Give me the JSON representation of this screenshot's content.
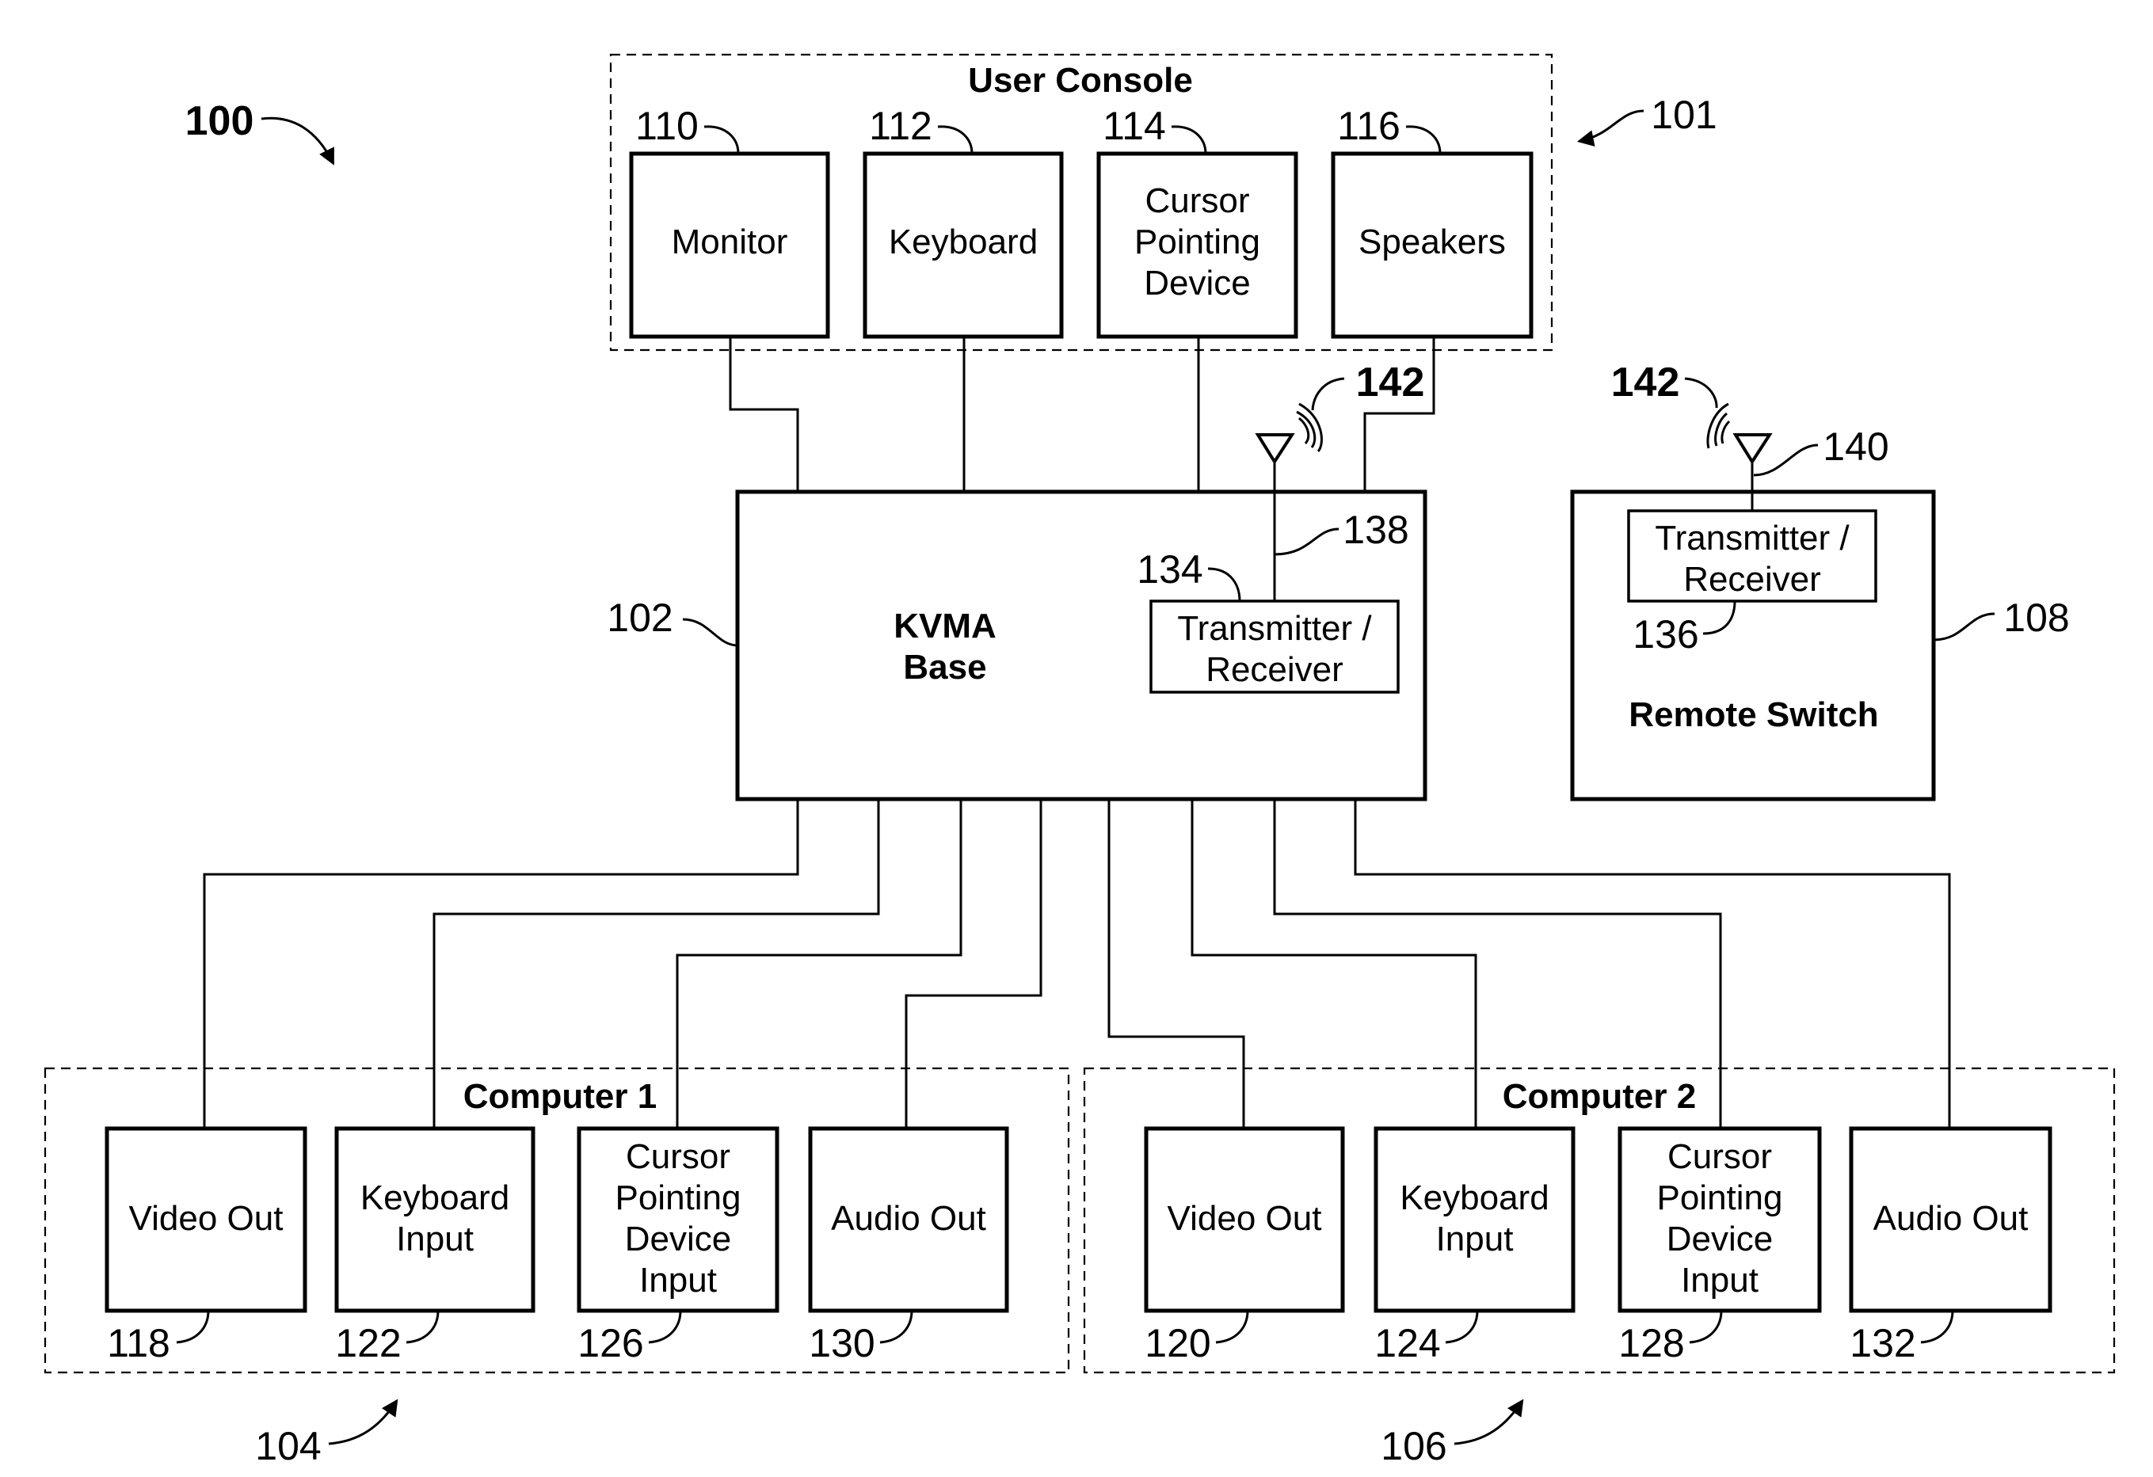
{
  "figure": {
    "ref": "100",
    "user_console": {
      "title": "User Console",
      "ref": "101",
      "devices": [
        {
          "ref": "110",
          "lines": [
            "Monitor"
          ]
        },
        {
          "ref": "112",
          "lines": [
            "Keyboard"
          ]
        },
        {
          "ref": "114",
          "lines": [
            "Cursor",
            "Pointing",
            "Device"
          ]
        },
        {
          "ref": "116",
          "lines": [
            "Speakers"
          ]
        }
      ]
    },
    "kvma_base": {
      "lines": [
        "KVMA",
        "Base"
      ],
      "ref": "102",
      "transceiver": {
        "lines": [
          "Transmitter /",
          "Receiver"
        ],
        "ref": "134"
      },
      "antenna_ref": "138",
      "signal_ref": "142"
    },
    "remote_switch": {
      "title": "Remote Switch",
      "ref": "108",
      "transceiver": {
        "lines": [
          "Transmitter /",
          "Receiver"
        ],
        "ref": "136"
      },
      "antenna_ref": "140",
      "signal_ref": "142"
    },
    "computers": [
      {
        "title": "Computer 1",
        "ref": "104",
        "ports": [
          {
            "ref": "118",
            "lines": [
              "Video Out"
            ]
          },
          {
            "ref": "122",
            "lines": [
              "Keyboard",
              "Input"
            ]
          },
          {
            "ref": "126",
            "lines": [
              "Cursor",
              "Pointing",
              "Device",
              "Input"
            ]
          },
          {
            "ref": "130",
            "lines": [
              "Audio Out"
            ]
          }
        ]
      },
      {
        "title": "Computer 2",
        "ref": "106",
        "ports": [
          {
            "ref": "120",
            "lines": [
              "Video Out"
            ]
          },
          {
            "ref": "124",
            "lines": [
              "Keyboard",
              "Input"
            ]
          },
          {
            "ref": "128",
            "lines": [
              "Cursor",
              "Pointing",
              "Device",
              "Input"
            ]
          },
          {
            "ref": "132",
            "lines": [
              "Audio Out"
            ]
          }
        ]
      }
    ]
  }
}
